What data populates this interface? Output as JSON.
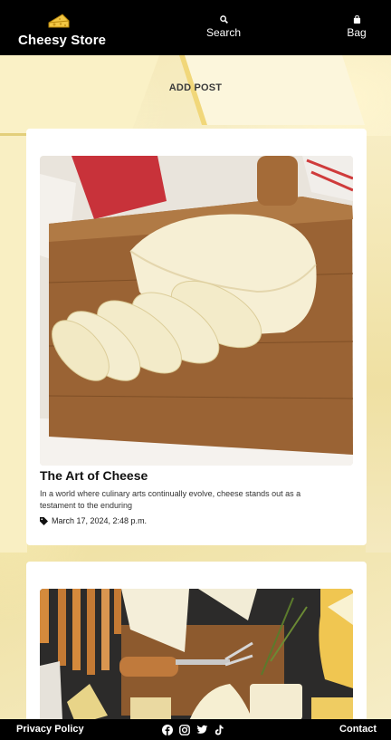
{
  "header": {
    "brand": "Cheesy Store",
    "logo_icon": "cheese-icon",
    "nav": {
      "search": "Search",
      "bag": "Bag"
    }
  },
  "main": {
    "add_post": "ADD POST",
    "posts": [
      {
        "title": "The Art of Cheese",
        "excerpt": "In a world where culinary arts continually evolve, cheese stands out as a testament to the enduring",
        "date": "March 17, 2024, 2:48 p.m.",
        "image": "sliced-cheese-on-cutting-board"
      },
      {
        "image": "cheese-platter"
      }
    ]
  },
  "footer": {
    "privacy": "Privacy Policy",
    "contact": "Contact",
    "socials": [
      "facebook-icon",
      "instagram-icon",
      "twitter-icon",
      "tiktok-icon"
    ]
  },
  "colors": {
    "bar": "#000000",
    "background": "#f4e7b0",
    "card": "#ffffff"
  }
}
